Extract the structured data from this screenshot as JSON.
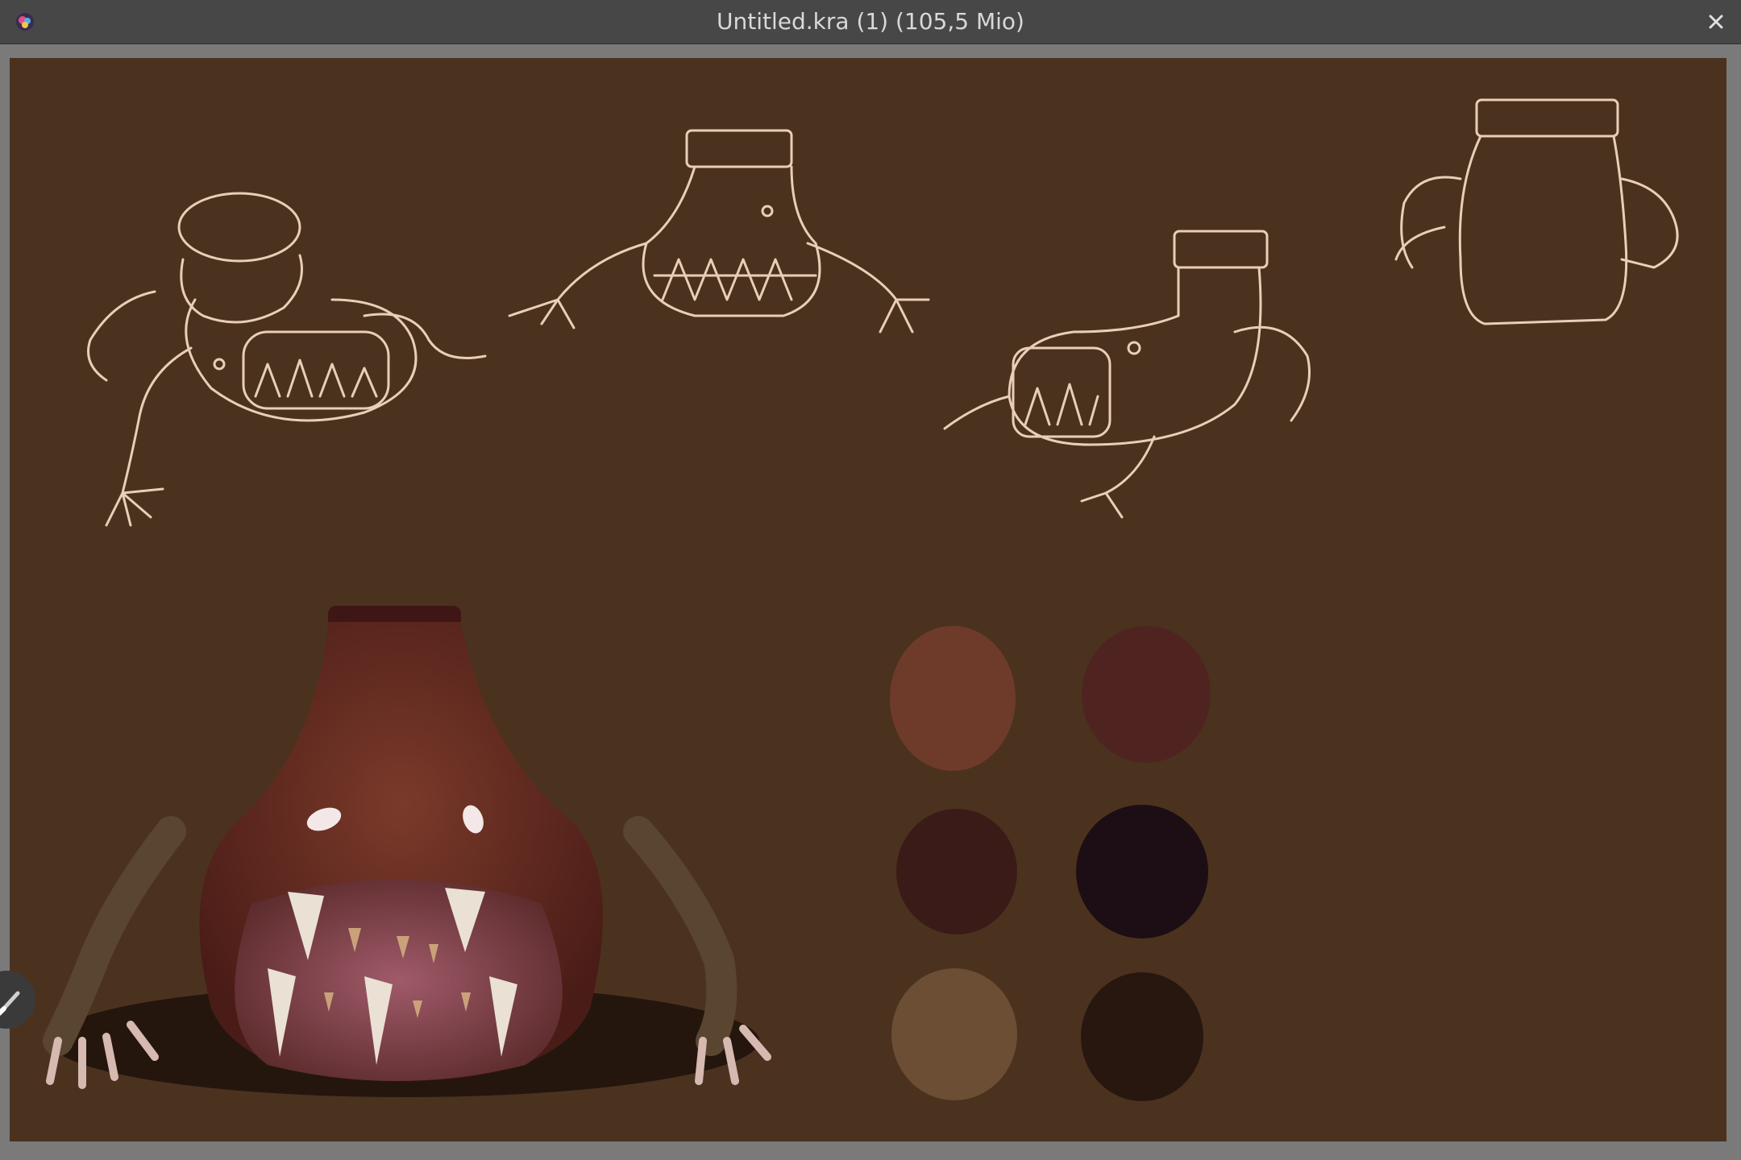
{
  "window": {
    "title": "Untitled.kra (1) (105,5 Mio)",
    "app_icon": "krita-icon",
    "close_icon": "close-icon"
  },
  "canvas": {
    "background": "#4b321f",
    "swatches": [
      "#6e3b2b",
      "#4f2420",
      "#3a1b17",
      "#1d0d14",
      "#6c4e35",
      "#27170f"
    ]
  },
  "tools": {
    "floating_tool_icon": "brush-icon"
  }
}
